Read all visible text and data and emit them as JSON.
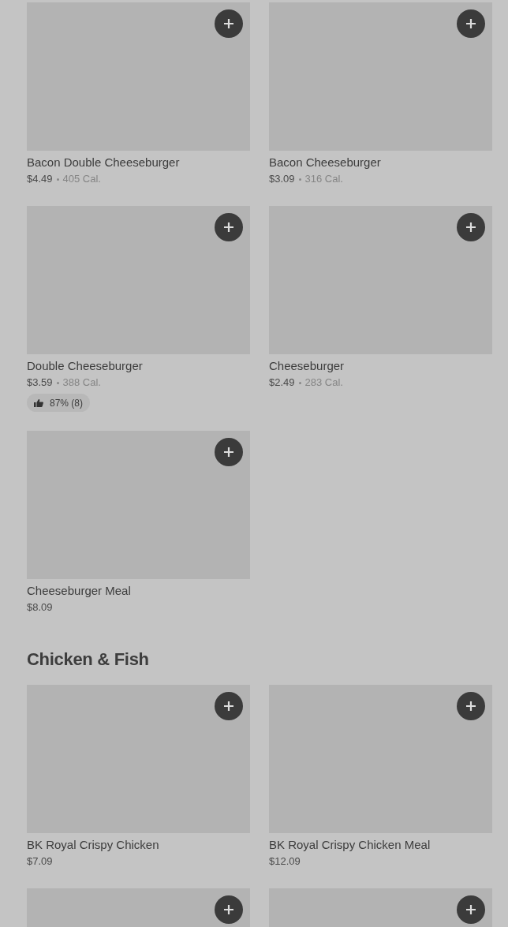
{
  "sections": [
    {
      "items": [
        {
          "kind": "full",
          "name": "Bacon Double Cheeseburger",
          "price": "$4.49",
          "calories": "405 Cal."
        },
        {
          "kind": "full",
          "name": "Bacon Cheeseburger",
          "price": "$3.09",
          "calories": "316 Cal."
        },
        {
          "kind": "full",
          "name": "Double Cheeseburger",
          "price": "$3.59",
          "calories": "388 Cal.",
          "rating": "87% (8)"
        },
        {
          "kind": "full",
          "name": "Cheeseburger",
          "price": "$2.49",
          "calories": "283 Cal."
        },
        {
          "kind": "full",
          "name": "Cheeseburger Meal",
          "price": "$8.09"
        }
      ]
    },
    {
      "title": "Chicken & Fish",
      "items": [
        {
          "kind": "full",
          "name": "BK Royal Crispy Chicken",
          "price": "$7.09"
        },
        {
          "kind": "full",
          "name": "BK Royal Crispy Chicken Meal",
          "price": "$12.09"
        },
        {
          "kind": "cutoff"
        },
        {
          "kind": "cutoff"
        }
      ]
    }
  ]
}
